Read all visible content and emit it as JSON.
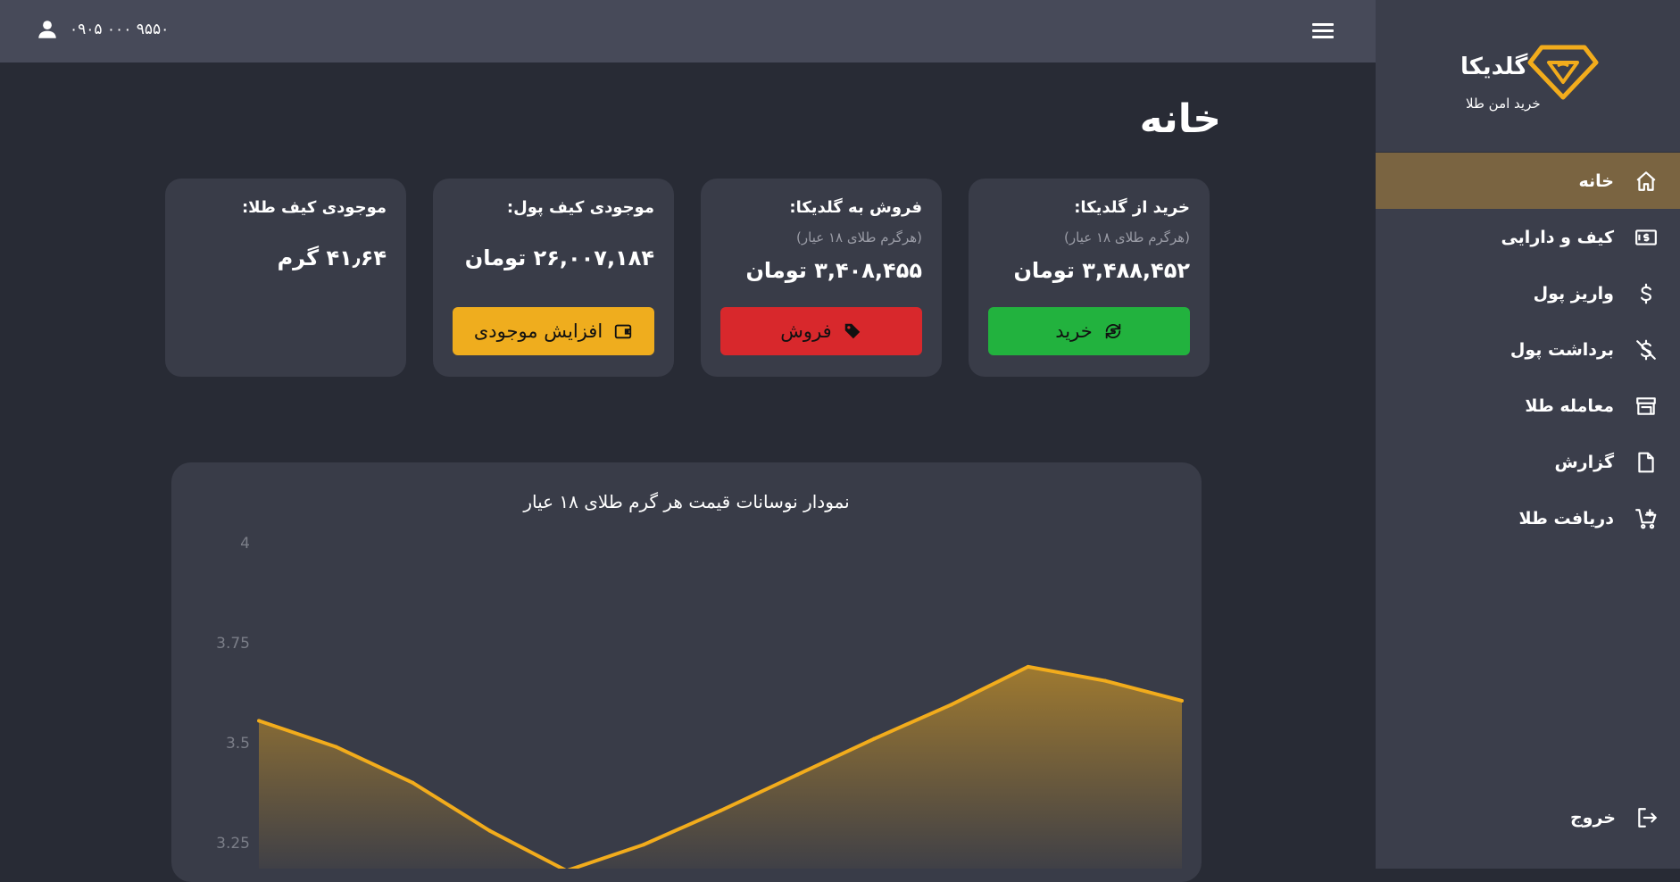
{
  "header": {
    "phone": "۰۹۰۵ ۰۰۰ ۹۵۵۰"
  },
  "brand": {
    "name": "گلدیکا",
    "tagline": "خرید امن طلا",
    "color": "#f2ac1c"
  },
  "sidebar": {
    "items": [
      {
        "label": "خانه",
        "icon": "home-icon",
        "active": true
      },
      {
        "label": "کیف و دارایی",
        "icon": "wallet-cash-icon"
      },
      {
        "label": "واریز پول",
        "icon": "dollar-icon"
      },
      {
        "label": "برداشت پول",
        "icon": "dollar-off-icon"
      },
      {
        "label": "معامله طلا",
        "icon": "store-icon"
      },
      {
        "label": "گزارش",
        "icon": "report-icon"
      },
      {
        "label": "دریافت طلا",
        "icon": "cart-icon"
      }
    ],
    "logout": "خروج"
  },
  "page": {
    "title": "خانه"
  },
  "cards": {
    "buy": {
      "title": "خرید از گلدیکا:",
      "subtitle": "(هرگرم طلای ۱۸ عیار)",
      "value": "۳,۴۸۸,۴۵۲ تومان",
      "button": "خرید",
      "color": "#22b23e"
    },
    "sell": {
      "title": "فروش به گلدیکا:",
      "subtitle": "(هرگرم طلای ۱۸ عیار)",
      "value": "۳,۴۰۸,۴۵۵ تومان",
      "button": "فروش",
      "color": "#d8282c"
    },
    "wallet": {
      "title": "موجودی کیف پول:",
      "value": "۲۶,۰۰۷,۱۸۴ تومان",
      "button": "افزایش موجودی",
      "color": "#efad1e"
    },
    "gold": {
      "title": "موجودی کیف طلا:",
      "value": "۴۱٫۶۴ گرم"
    }
  },
  "chart_data": {
    "type": "area",
    "title": "نمودار نوسانات قیمت هر گرم طلای ۱۸ عیار",
    "yticks": [
      "4",
      "3.75",
      "3.5",
      "3.25"
    ],
    "ylim": [
      3.2,
      4
    ],
    "values": [
      3.555,
      3.49,
      3.4,
      3.28,
      3.18,
      3.245,
      3.33,
      3.42,
      3.51,
      3.595,
      3.69,
      3.655,
      3.605
    ],
    "color": "#f2ac1c",
    "grid": false
  }
}
